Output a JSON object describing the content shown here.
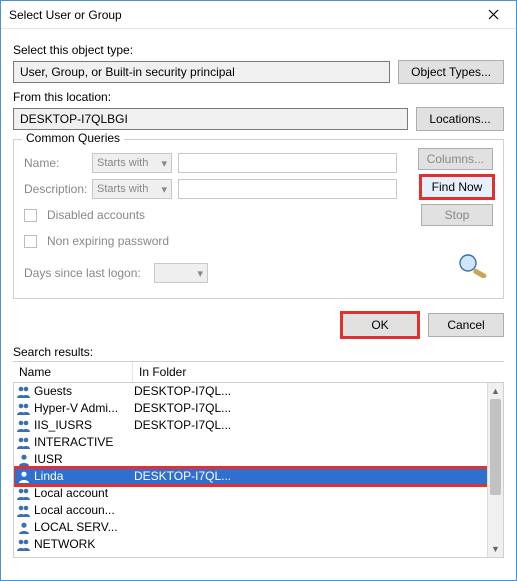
{
  "title": "Select User or Group",
  "labels": {
    "objectType": "Select this object type:",
    "fromLocation": "From this location:",
    "commonQueries": "Common Queries",
    "name": "Name:",
    "description": "Description:",
    "startsWith": "Starts with",
    "disabledAccounts": "Disabled accounts",
    "nonExpiring": "Non expiring password",
    "daysSince": "Days since last logon:",
    "searchResults": "Search results:"
  },
  "fields": {
    "objectType": "User, Group, or Built-in security principal",
    "location": "DESKTOP-I7QLBGI"
  },
  "buttons": {
    "objectTypes": "Object Types...",
    "locations": "Locations...",
    "columns": "Columns...",
    "findNow": "Find Now",
    "stop": "Stop",
    "ok": "OK",
    "cancel": "Cancel"
  },
  "columns": {
    "name": "Name",
    "folder": "In Folder"
  },
  "results": [
    {
      "name": "Guests",
      "folder": "DESKTOP-I7QL...",
      "icon": "group",
      "selected": false
    },
    {
      "name": "Hyper-V Admi...",
      "folder": "DESKTOP-I7QL...",
      "icon": "group",
      "selected": false
    },
    {
      "name": "IIS_IUSRS",
      "folder": "DESKTOP-I7QL...",
      "icon": "group",
      "selected": false
    },
    {
      "name": "INTERACTIVE",
      "folder": "",
      "icon": "group",
      "selected": false
    },
    {
      "name": "IUSR",
      "folder": "",
      "icon": "user",
      "selected": false
    },
    {
      "name": "Linda",
      "folder": "DESKTOP-I7QL...",
      "icon": "user",
      "selected": true
    },
    {
      "name": "Local account",
      "folder": "",
      "icon": "group",
      "selected": false
    },
    {
      "name": "Local accoun...",
      "folder": "",
      "icon": "group",
      "selected": false
    },
    {
      "name": "LOCAL SERV...",
      "folder": "",
      "icon": "user",
      "selected": false
    },
    {
      "name": "NETWORK",
      "folder": "",
      "icon": "group",
      "selected": false
    }
  ]
}
